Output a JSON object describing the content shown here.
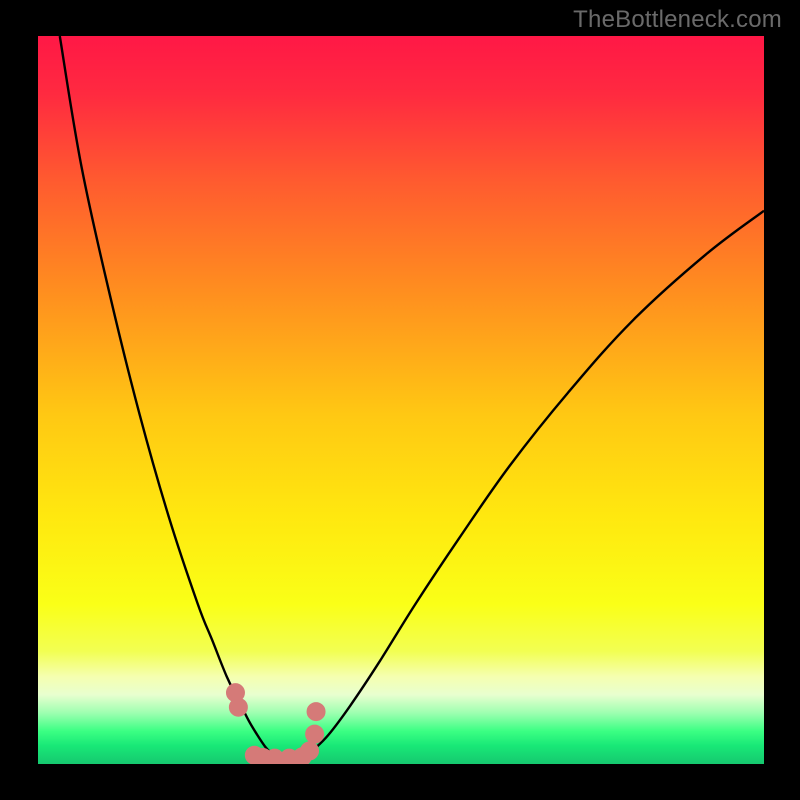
{
  "watermark": "TheBottleneck.com",
  "colors": {
    "frame": "#000000",
    "curve": "#000000",
    "marker_fill": "#d57a78",
    "marker_stroke": "#d57a78",
    "gradient_stops": [
      {
        "offset": 0.0,
        "color": "#ff1846"
      },
      {
        "offset": 0.08,
        "color": "#ff2a40"
      },
      {
        "offset": 0.2,
        "color": "#ff5b2f"
      },
      {
        "offset": 0.35,
        "color": "#ff8e1f"
      },
      {
        "offset": 0.52,
        "color": "#ffc813"
      },
      {
        "offset": 0.66,
        "color": "#ffe80f"
      },
      {
        "offset": 0.78,
        "color": "#faff17"
      },
      {
        "offset": 0.845,
        "color": "#f2ff52"
      },
      {
        "offset": 0.88,
        "color": "#f5ffb0"
      },
      {
        "offset": 0.905,
        "color": "#e8ffcf"
      },
      {
        "offset": 0.93,
        "color": "#9dffb0"
      },
      {
        "offset": 0.955,
        "color": "#3bff83"
      },
      {
        "offset": 0.975,
        "color": "#18e877"
      },
      {
        "offset": 1.0,
        "color": "#16c86f"
      }
    ]
  },
  "chart_data": {
    "type": "line",
    "title": "",
    "xlabel": "",
    "ylabel": "",
    "xlim": [
      0,
      100
    ],
    "ylim": [
      0,
      100
    ],
    "grid": false,
    "legend": false,
    "series": [
      {
        "name": "descending-branch",
        "x": [
          3,
          6,
          10,
          14,
          18,
          22,
          24,
          26,
          27.5,
          29,
          30.2,
          31.2,
          31.8
        ],
        "y": [
          100,
          82,
          64,
          48,
          34,
          22,
          17,
          12,
          9,
          6,
          4,
          2.5,
          1.8
        ]
      },
      {
        "name": "ascending-branch",
        "x": [
          38,
          40,
          43,
          47,
          52,
          58,
          65,
          73,
          82,
          92,
          100
        ],
        "y": [
          2,
          4,
          8,
          14,
          22,
          31,
          41,
          51,
          61,
          70,
          76
        ]
      },
      {
        "name": "valley-markers",
        "x": [
          27.2,
          27.6,
          29.8,
          31.0,
          32.6,
          34.6,
          36.4,
          37.4,
          38.1,
          38.3
        ],
        "y": [
          9.8,
          7.8,
          1.2,
          0.9,
          0.8,
          0.8,
          1.0,
          1.8,
          4.1,
          7.2
        ]
      }
    ],
    "annotations": [
      {
        "text": "TheBottleneck.com",
        "position": "top-right"
      }
    ]
  }
}
